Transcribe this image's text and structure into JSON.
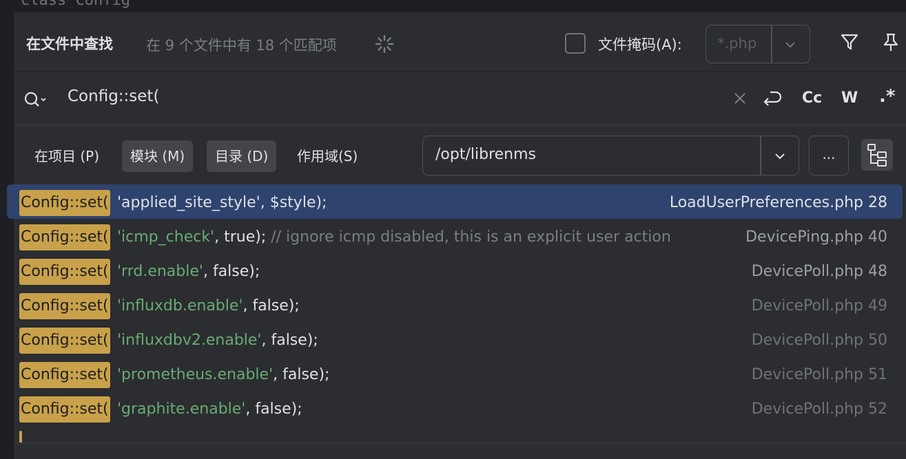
{
  "editor_peek": "class Config",
  "header": {
    "title": "在文件中查找",
    "summary": "在 9 个文件中有 18 个匹配项",
    "file_mask_label": "文件掩码(A):",
    "file_mask_value": "*.php",
    "file_mask_checked": false
  },
  "search": {
    "query": "Config::set(",
    "case_label": "Cc",
    "word_label": "W",
    "regex_label": ".*"
  },
  "scope": {
    "project": "在项目 (P)",
    "module": "模块 (M)",
    "directory": "目录 (D)",
    "scope": "作用域(S)",
    "active": "directory",
    "directory_path": "/opt/librenms",
    "browse": "..."
  },
  "results": [
    {
      "match": "Config::set(",
      "string": "'applied_site_style'",
      "rest": ", $style);",
      "comment": "",
      "file": "LoadUserPreferences.php 28",
      "selected": true
    },
    {
      "match": "Config::set(",
      "string": "'icmp_check'",
      "rest": ", true); ",
      "comment": "// ignore icmp disabled, this is an explicit user action",
      "file": "DevicePing.php 40",
      "selected": false
    },
    {
      "match": "Config::set(",
      "string": "'rrd.enable'",
      "rest": ", false);",
      "comment": "",
      "file": "DevicePoll.php 48",
      "selected": false
    },
    {
      "match": "Config::set(",
      "string": "'influxdb.enable'",
      "rest": ", false);",
      "comment": "",
      "file": "DevicePoll.php 49",
      "selected": false
    },
    {
      "match": "Config::set(",
      "string": "'influxdbv2.enable'",
      "rest": ", false);",
      "comment": "",
      "file": "DevicePoll.php 50",
      "selected": false
    },
    {
      "match": "Config::set(",
      "string": "'prometheus.enable'",
      "rest": ", false);",
      "comment": "",
      "file": "DevicePoll.php 51",
      "selected": false
    },
    {
      "match": "Config::set(",
      "string": "'graphite.enable'",
      "rest": ", false);",
      "comment": "",
      "file": "DevicePoll.php 52",
      "selected": false
    }
  ],
  "colors": {
    "selection": "#2e436e",
    "match_highlight": "#c9a14a",
    "string": "#6aab73"
  }
}
